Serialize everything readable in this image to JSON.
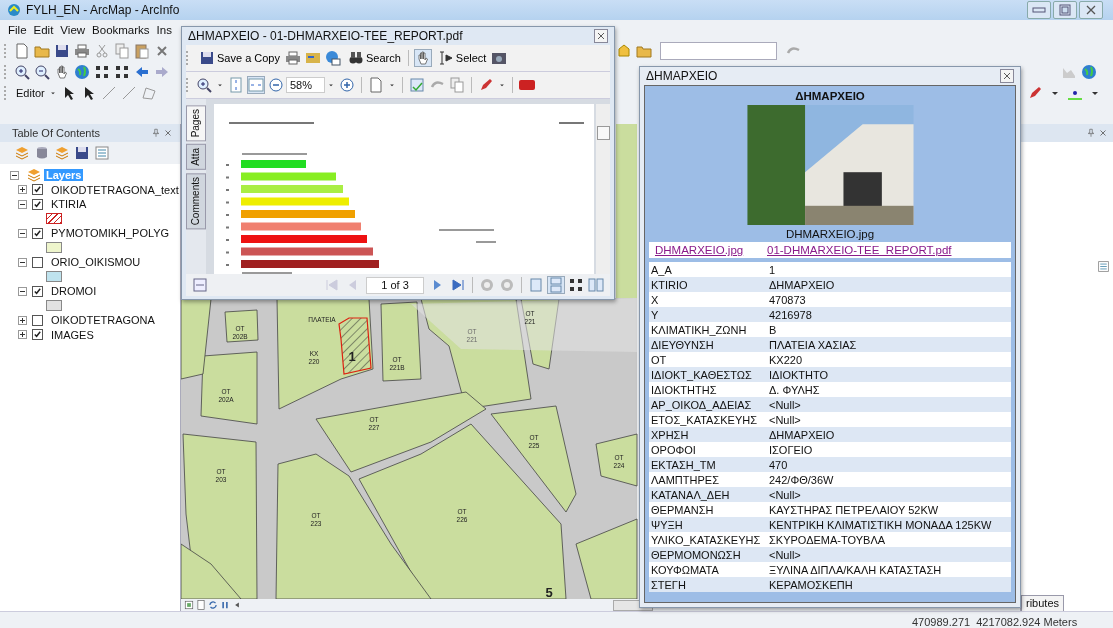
{
  "window": {
    "title": "FYLH_EN - ArcMap - ArcInfo"
  },
  "menu": [
    "File",
    "Edit",
    "View",
    "Bookmarks",
    "Ins"
  ],
  "editor_menu": "Editor",
  "toc": {
    "title": "Table Of Contents",
    "root": {
      "name": "Layers",
      "selected": true,
      "expanded": true,
      "children": [
        {
          "name": "OIKODTETRAGONA_text",
          "checked": true,
          "expanded": false
        },
        {
          "name": "KTIRIA",
          "checked": true,
          "expanded": true,
          "symbol": {
            "kind": "hatch",
            "color": "#cc2222"
          }
        },
        {
          "name": "PYMOTOMIKH_POLYG",
          "checked": true,
          "expanded": true,
          "symbol": {
            "kind": "fill",
            "color": "#eef5cc"
          }
        },
        {
          "name": "ORIO_OIKISMOU",
          "checked": false,
          "expanded": true,
          "symbol": {
            "kind": "fill",
            "color": "#bfe3ee"
          }
        },
        {
          "name": "DROMOI",
          "checked": true,
          "expanded": true,
          "symbol": {
            "kind": "fill",
            "color": "#e2e2e2"
          }
        },
        {
          "name": "OIKODTETRAGONA",
          "checked": false,
          "expanded": false
        },
        {
          "name": "IMAGES",
          "checked": true,
          "expanded": false
        }
      ]
    }
  },
  "map": {
    "labels": [
      "ΟΤ 202Β",
      "ΠΛΑΤΕΙΑ",
      "ΚΧ 220",
      "1",
      "ΟΤ 221Β",
      "ΟΤ 221",
      "ΟΤ 221",
      "ΟΤ 202Α",
      "ΟΤ 227",
      "ΟΤ 225",
      "ΟΤ 224",
      "ΟΤ 203",
      "ΟΤ 223",
      "ΟΤ 226",
      "5"
    ]
  },
  "pdf_viewer": {
    "title": "ΔΗΜΑΡΧΕΙΟ - 01-DHMARXEIO-TEE_REPORT.pdf",
    "save_button": "Save a Copy",
    "search_button": "Search",
    "select_button": "Select",
    "zoom": "58%",
    "side_tabs": [
      {
        "label": "Pages",
        "selected": true
      },
      {
        "label": "Atta",
        "selected": false
      },
      {
        "label": "Comments",
        "selected": false
      }
    ],
    "page_field": "1 of 3"
  },
  "identify_popup": {
    "title": "ΔΗΜΑΡΧΕΙΟ",
    "heading": "ΔΗΜΑΡΧΕΙΟ",
    "photo_caption": "DHMARXEIO.jpg",
    "links": [
      "DHMARXEIO.jpg",
      "01-DHMARXEIO-TEE_REPORT.pdf"
    ],
    "attributes": [
      {
        "field": "A_A",
        "value": "1"
      },
      {
        "field": "KTIRIO",
        "value": "ΔΗΜΑΡΧΕΙΟ"
      },
      {
        "field": "X",
        "value": "470873"
      },
      {
        "field": "Y",
        "value": "4216978"
      },
      {
        "field": "ΚΛΙΜΑΤΙΚΗ_ΖΩΝΗ",
        "value": "B"
      },
      {
        "field": "ΔΙΕΥΘΥΝΣΗ",
        "value": "ΠΛΑΤΕΙΑ ΧΑΣΙΑΣ"
      },
      {
        "field": "ΟΤ",
        "value": "ΚΧ220"
      },
      {
        "field": "ΙΔΙΟΚΤ_ΚΑΘΕΣΤΩΣ",
        "value": "ΙΔΙΟΚΤΗΤΟ"
      },
      {
        "field": "ΙΔΙΟΚΤΗΤΗΣ",
        "value": "Δ. ΦΥΛΗΣ"
      },
      {
        "field": "ΑΡ_ΟΙΚΟΔ_ΑΔΕΙΑΣ",
        "value": "<Null>"
      },
      {
        "field": "ΕΤΟΣ_ΚΑΤΑΣΚΕΥΗΣ",
        "value": "<Null>"
      },
      {
        "field": "ΧΡΗΣΗ",
        "value": "ΔΗΜΑΡΧΕΙΟ"
      },
      {
        "field": "ΟΡΟΦΟΙ",
        "value": "ΙΣΟΓΕΙΟ"
      },
      {
        "field": "ΕΚΤΑΣΗ_ΤΜ",
        "value": "470"
      },
      {
        "field": "ΛΑΜΠΤΗΡΕΣ",
        "value": "242/ΦΘ/36W"
      },
      {
        "field": "ΚΑΤΑΝΑΛ_ΔΕΗ",
        "value": "<Null>"
      },
      {
        "field": "ΘΕΡΜΑΝΣΗ",
        "value": "ΚΑΥΣΤΗΡΑΣ ΠΕΤΡΕΛΑΙΟΥ 52KW"
      },
      {
        "field": "ΨΥΞΗ",
        "value": "ΚΕΝΤΡΙΚΗ ΚΛΙΜΑΤΙΣΤΙΚΗ ΜΟΝΑΔΑ 125KW"
      },
      {
        "field": "ΥΛΙΚΟ_ΚΑΤΑΣΚΕΥΗΣ",
        "value": "ΣΚΥΡΟΔΕΜΑ-ΤΟΥΒΛΑ"
      },
      {
        "field": "ΘΕΡΜΟΜΟΝΩΣΗ",
        "value": "<Null>"
      },
      {
        "field": "ΚΟΥΦΩΜΑΤΑ",
        "value": "ΞΥΛΙΝΑ ΔΙΠΛΑ/ΚΑΛΗ ΚΑΤΑΣΤΑΣΗ"
      },
      {
        "field": "ΣΤΕΓΗ",
        "value": "ΚΕΡΑΜΟΣΚΕΠΗ"
      }
    ]
  },
  "side_panel": {
    "tab": "ributes"
  },
  "status_bar": {
    "coordinates": "470989.271  4217082.924 Meters"
  }
}
